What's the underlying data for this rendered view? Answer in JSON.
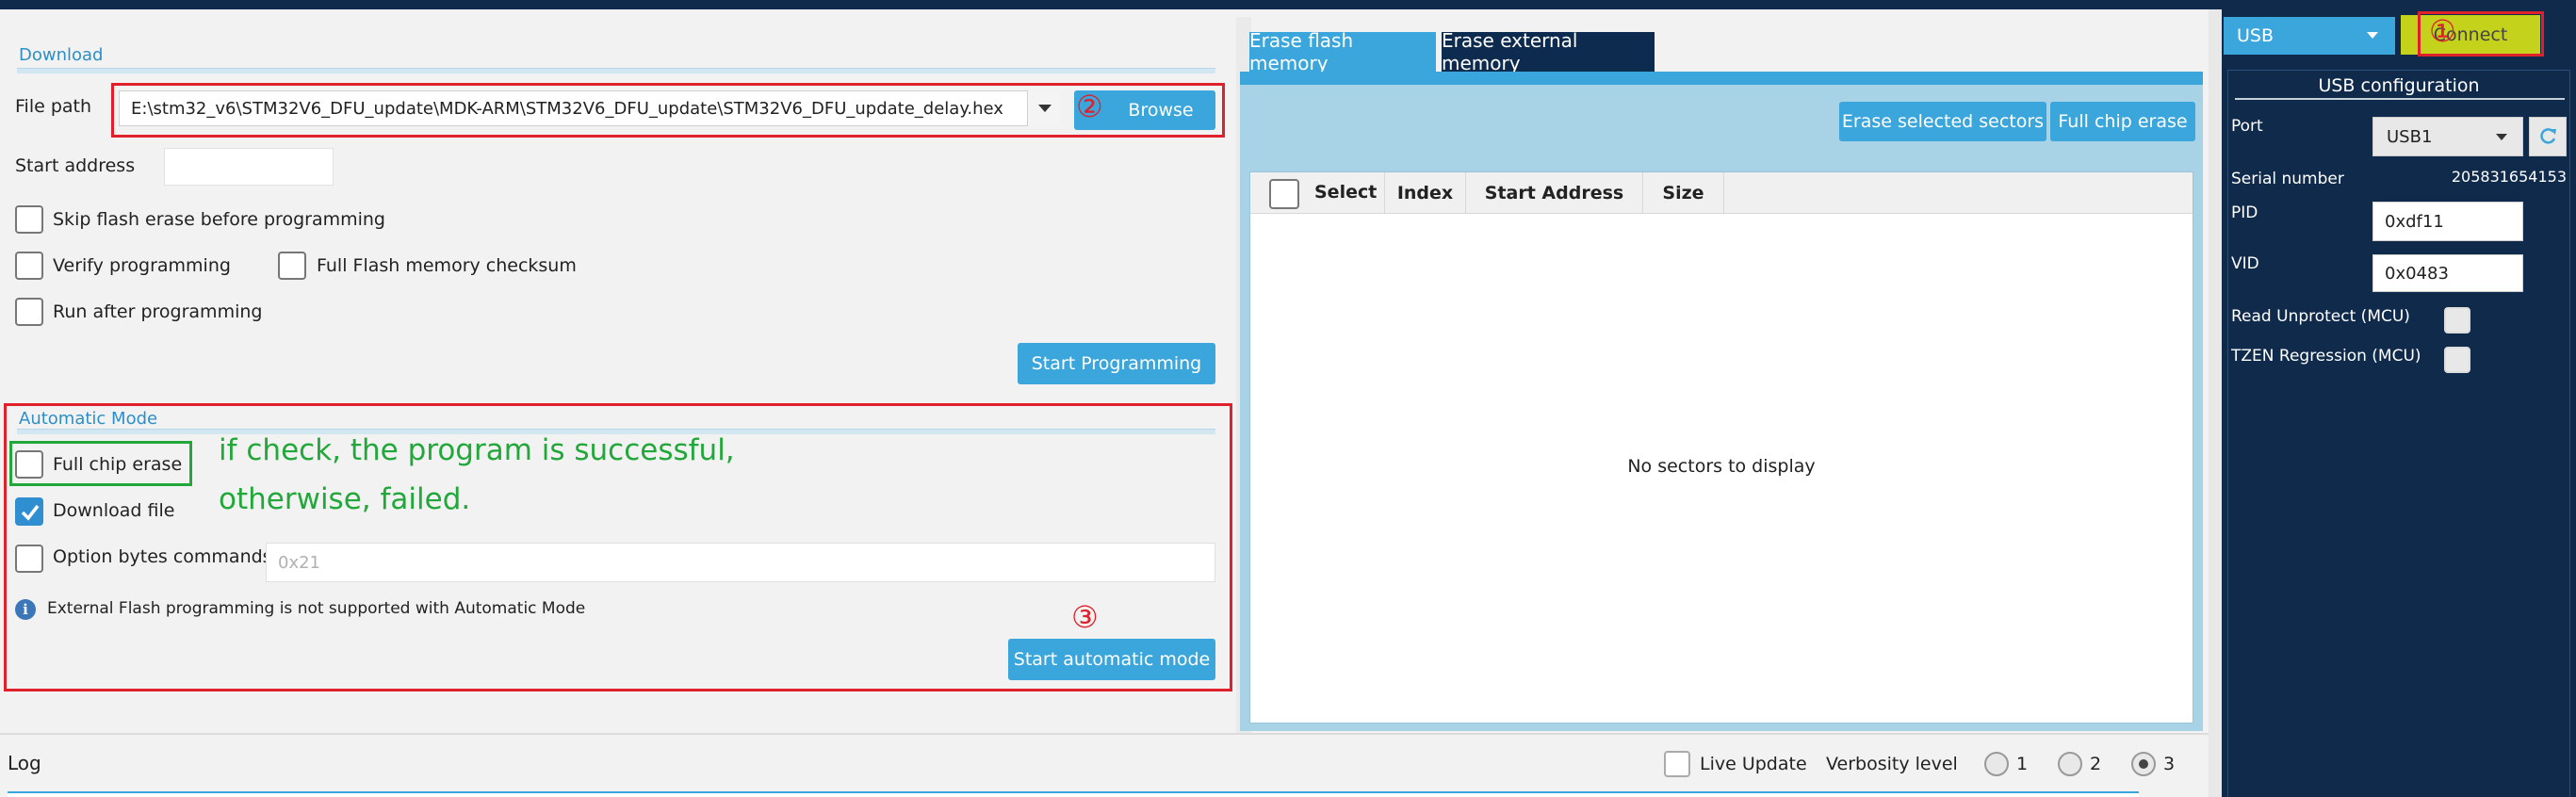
{
  "download": {
    "section_title": "Download",
    "file_path_label": "File path",
    "file_path_value": "E:\\stm32_v6\\STM32V6_DFU_update\\MDK-ARM\\STM32V6_DFU_update\\STM32V6_DFU_update_delay.hex",
    "browse_label": "Browse",
    "start_address_label": "Start address",
    "start_address_value": "",
    "skip_erase_label": "Skip flash erase before programming",
    "verify_label": "Verify programming",
    "full_checksum_label": "Full Flash memory checksum",
    "run_after_label": "Run after programming",
    "start_programming_label": "Start Programming"
  },
  "automatic": {
    "section_title": "Automatic Mode",
    "full_chip_erase_label": "Full chip erase",
    "full_chip_erase_checked": false,
    "download_file_label": "Download file",
    "download_file_checked": true,
    "option_bytes_label": "Option bytes commands",
    "option_bytes_placeholder": "0x21",
    "note": "External Flash programming is not supported with Automatic Mode",
    "start_automatic_label": "Start automatic mode"
  },
  "annotations": {
    "circle_1": "①",
    "circle_2": "②",
    "circle_3": "③",
    "note_line1": "if check, the program is successful,",
    "note_line2": "otherwise, failed."
  },
  "erase": {
    "tabs": [
      {
        "label": "Erase flash memory",
        "active": true
      },
      {
        "label": "Erase external memory",
        "active": false
      }
    ],
    "erase_selected_label": "Erase selected sectors",
    "full_chip_erase_label": "Full chip erase",
    "columns": [
      "Select",
      "Index",
      "Start Address",
      "Size"
    ],
    "empty_message": "No sectors to display"
  },
  "connection": {
    "interface_value": "USB",
    "connect_label": "Connect",
    "config_title": "USB configuration",
    "port_label": "Port",
    "port_value": "USB1",
    "serial_label": "Serial number",
    "serial_value": "205831654153",
    "pid_label": "PID",
    "pid_value": "0xdf11",
    "vid_label": "VID",
    "vid_value": "0x0483",
    "read_unprotect_label": "Read Unprotect (MCU)",
    "tzen_label": "TZEN Regression (MCU)"
  },
  "log": {
    "title": "Log",
    "live_update_label": "Live Update",
    "verbosity_label": "Verbosity level",
    "levels": [
      "1",
      "2",
      "3"
    ],
    "selected_level": "3"
  },
  "colors": {
    "accent": "#3aa6dc",
    "annotation_red": "#e0202a",
    "annotation_green": "#22a83a",
    "connect_yellow": "#c5d21c",
    "panel_dark": "#0f2a4a",
    "tab_dark": "#0d2b4e"
  },
  "icons": [
    "chevron-down-icon",
    "refresh-icon",
    "info-icon",
    "checkmark-icon"
  ]
}
